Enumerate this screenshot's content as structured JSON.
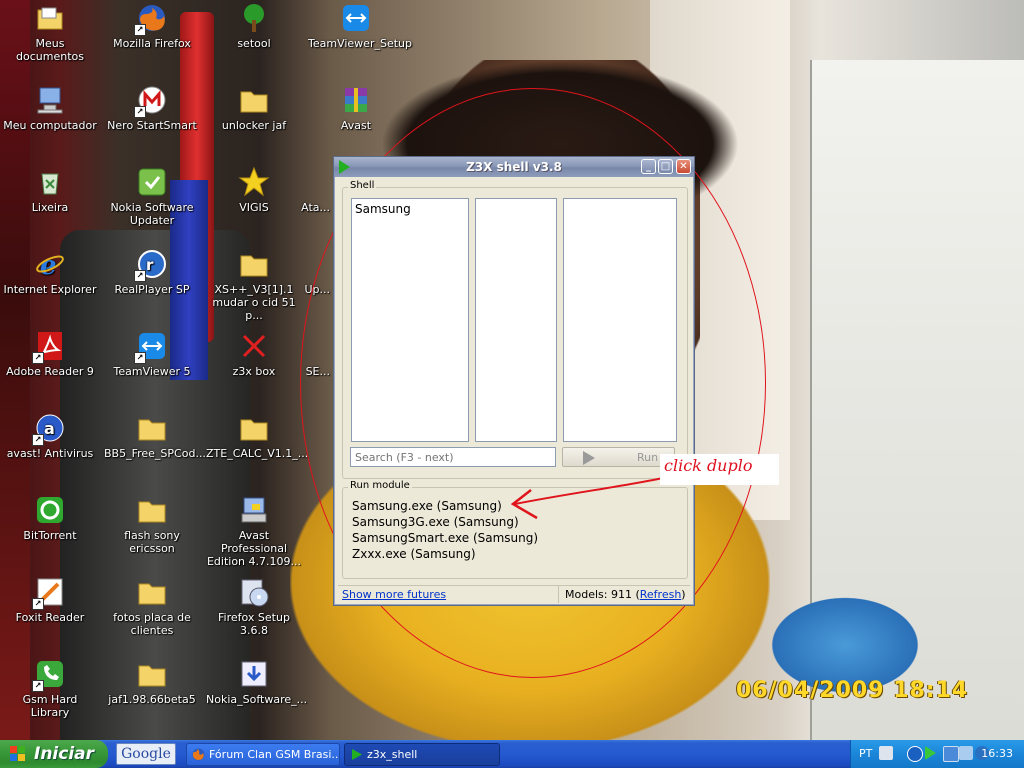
{
  "desktop": {
    "icons": [
      {
        "label": "Meus documentos"
      },
      {
        "label": "Mozilla Firefox"
      },
      {
        "label": "setool"
      },
      {
        "label": "TeamViewer_Setup"
      },
      {
        "label": "Meu computador"
      },
      {
        "label": "Nero StartSmart"
      },
      {
        "label": "unlocker jaf"
      },
      {
        "label": "Avast"
      },
      {
        "label": "Lixeira"
      },
      {
        "label": "Nokia Software Updater"
      },
      {
        "label": "VIGIS"
      },
      {
        "label": "Ata..."
      },
      {
        "label": "Internet Explorer"
      },
      {
        "label": "RealPlayer SP"
      },
      {
        "label": "XS++_V3[1].1 mudar o cid 51 p..."
      },
      {
        "label": "Up..."
      },
      {
        "label": "Adobe Reader 9"
      },
      {
        "label": "TeamViewer 5"
      },
      {
        "label": "z3x box"
      },
      {
        "label": "SE..."
      },
      {
        "label": "avast! Antivirus"
      },
      {
        "label": "BB5_Free_SPCod..."
      },
      {
        "label": "ZTE_CALC_V1.1_..."
      },
      {
        "label": "BitTorrent"
      },
      {
        "label": "flash sony ericsson"
      },
      {
        "label": "Avast Professional Edition 4.7.109..."
      },
      {
        "label": "Foxit Reader"
      },
      {
        "label": "fotos placa de clientes"
      },
      {
        "label": "Firefox Setup 3.6.8"
      },
      {
        "label": "Gsm Hard Library"
      },
      {
        "label": "jaf1.98.66beta5"
      },
      {
        "label": "Nokia_Software_..."
      }
    ],
    "photo_timestamp": "06/04/2009 18:14"
  },
  "window": {
    "title": "Z3X shell v3.8",
    "shell_group_label": "Shell",
    "list_items": [
      "Samsung"
    ],
    "search_placeholder": "Search (F3 - next)",
    "run_label": "Run",
    "run_module_label": "Run module",
    "modules": [
      "Samsung.exe (Samsung)",
      "Samsung3G.exe (Samsung)",
      "SamsungSmart.exe (Samsung)",
      "Zxxx.exe (Samsung)"
    ],
    "show_more_link": "Show more futures",
    "models_prefix": "Models: 911 (",
    "refresh_link": "Refresh",
    "models_suffix": ")"
  },
  "annotation": {
    "text": "click duplo",
    "color": "#e01020"
  },
  "taskbar": {
    "start_label": "Iniciar",
    "google_label": "Google",
    "tasks": [
      {
        "label": "Fórum Clan GSM Brasi..."
      },
      {
        "label": "z3x_shell"
      }
    ],
    "language": "PT",
    "clock": "16:33"
  },
  "colors": {
    "taskbar_blue": "#245ad0",
    "start_green": "#3a9a3a",
    "accent_red": "#e0141c"
  }
}
